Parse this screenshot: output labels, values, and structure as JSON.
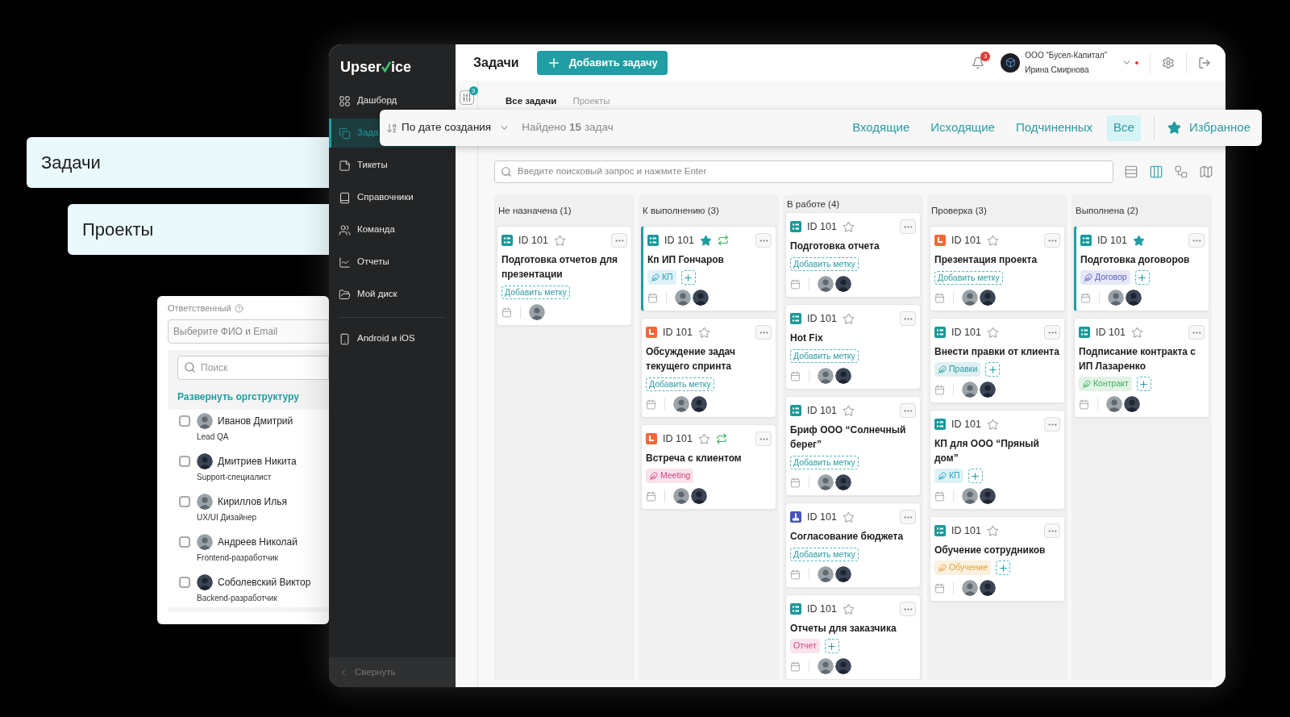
{
  "callouts": [
    {
      "label": "Задачи"
    },
    {
      "label": "Проекты"
    }
  ],
  "assignee_panel": {
    "label": "Ответственный",
    "select": {
      "placeholder": "Выберите ФИО и Email"
    },
    "search": {
      "placeholder": "Поиск"
    },
    "link": "Развернуть оргструктуру",
    "people": [
      {
        "name": "Иванов Дмитрий",
        "role": "Lead QA",
        "checked": false,
        "avatar": {
          "kind": "light"
        }
      },
      {
        "name": "Дмитриев Никита",
        "role": "Support-специалист",
        "checked": false,
        "avatar": {
          "kind": "dark"
        }
      },
      {
        "name": "Кириллов Илья",
        "role": "UX/UI Дизайнер",
        "checked": false,
        "avatar": {
          "kind": "light"
        }
      },
      {
        "name": "Андреев Николай",
        "role": "Frontend-разработчик",
        "checked": false,
        "avatar": {
          "kind": "light"
        }
      },
      {
        "name": "Соболевский Виктор",
        "role": "Backend-разработчик",
        "checked": false,
        "avatar": {
          "kind": "dark"
        }
      }
    ]
  },
  "sidebar": {
    "logo_start": "Upser",
    "logo_end": "ice",
    "sections": [
      [
        {
          "label": "Дашборд",
          "selected": false
        },
        {
          "label": "Зада",
          "selected": true
        },
        {
          "label": "Тикеты",
          "selected": false
        },
        {
          "label": "Справочники",
          "selected": false
        },
        {
          "label": "Команда",
          "selected": false
        },
        {
          "label": "Отчеты",
          "selected": false
        },
        {
          "label": "Мой диск",
          "selected": false
        }
      ],
      [
        {
          "label": "Android и iOS",
          "selected": false
        }
      ]
    ],
    "collapse": "Свернуть"
  },
  "header": {
    "title": "Задачи",
    "add_button": "Добавить задачу",
    "notifications": "3",
    "company": "ООО “Бусел-Капитал”",
    "user": "Ирина Смирнова",
    "alert": true
  },
  "filters_badge": "3",
  "tabs": [
    {
      "label": "Все задачи",
      "selected": true
    },
    {
      "label": "Проекты",
      "selected": false
    }
  ],
  "toolbar": {
    "sort": "По дате создания",
    "found": "Найдено **15** задач",
    "filters": [
      {
        "label": "Входящие",
        "selected": false
      },
      {
        "label": "Исходящие",
        "selected": false
      },
      {
        "label": "Подчиненных",
        "selected": false
      },
      {
        "label": "Все",
        "selected": true
      }
    ],
    "favorites": "Избранное"
  },
  "search": {
    "placeholder": "Введите поисковый запрос и нажмите Enter"
  },
  "views": [
    {
      "selected": false
    },
    {
      "selected": true
    },
    {
      "selected": false
    },
    {
      "selected": false
    }
  ],
  "board": {
    "columns": [
      {
        "title": "Не назначена (1)",
        "cards": [
          {
            "id": "ID 101",
            "kind": "list",
            "starred": false,
            "highlighted": false,
            "title": "Подготовка отчетов для презентации",
            "add_label": "Добавить метку",
            "avatars": [
              {
                "kind": "light"
              }
            ]
          }
        ]
      },
      {
        "title": "К выполнению (3)",
        "cards": [
          {
            "id": "ID 101",
            "kind": "list",
            "starred": true,
            "repeat": true,
            "highlighted": true,
            "title": "Кп ИП Гончаров",
            "tags": [
              {
                "label": "КП",
                "color": "#2aa5c4",
                "icon": true
              }
            ],
            "plus": true,
            "avatars": [
              {
                "kind": "light"
              },
              {
                "kind": "dark"
              }
            ]
          },
          {
            "id": "ID 101",
            "kind": "clock",
            "starred": false,
            "highlighted": false,
            "title": "Обсуждение задач текущего спринта",
            "add_label": "Добавить метку",
            "avatars": [
              {
                "kind": "light"
              },
              {
                "kind": "dark"
              }
            ]
          },
          {
            "id": "ID 101",
            "kind": "clock",
            "starred": false,
            "repeat": true,
            "highlighted": false,
            "title": "Встреча с клиентом",
            "tags": [
              {
                "label": "Meeting",
                "color": "#d6457f",
                "icon": true
              }
            ],
            "avatars": [
              {
                "kind": "light"
              },
              {
                "kind": "dark"
              }
            ]
          }
        ]
      },
      {
        "title": "В работе (4)",
        "cards": [
          {
            "id": "ID 101",
            "kind": "list",
            "starred": false,
            "highlighted": false,
            "title": "Подготовка отчета",
            "add_label": "Добавить метку",
            "avatars": [
              {
                "kind": "light"
              },
              {
                "kind": "dark"
              }
            ]
          },
          {
            "id": "ID 101",
            "kind": "list",
            "starred": false,
            "highlighted": false,
            "title": "Hot Fix",
            "add_label": "Добавить метку",
            "avatars": [
              {
                "kind": "light"
              },
              {
                "kind": "dark"
              }
            ]
          },
          {
            "id": "ID 101",
            "kind": "list",
            "starred": false,
            "highlighted": false,
            "title": "Бриф ООО “Солнечный берег”",
            "add_label": "Добавить метку",
            "avatars": [
              {
                "kind": "light"
              },
              {
                "kind": "dark"
              }
            ]
          },
          {
            "id": "ID 101",
            "kind": "budget",
            "starred": false,
            "highlighted": false,
            "title": "Согласование бюджета",
            "add_label": "Добавить метку",
            "avatars": [
              {
                "kind": "light"
              },
              {
                "kind": "dark"
              }
            ]
          },
          {
            "id": "ID 101",
            "kind": "list",
            "starred": false,
            "highlighted": false,
            "title": "Отчеты для заказчика",
            "tags": [
              {
                "label": "Отчет",
                "color": "#d6457f",
                "icon": false
              }
            ],
            "plus": true,
            "avatars": [
              {
                "kind": "light"
              },
              {
                "kind": "dark"
              }
            ]
          }
        ]
      },
      {
        "title": "Проверка (3)",
        "cards": [
          {
            "id": "ID 101",
            "kind": "clock",
            "starred": false,
            "highlighted": false,
            "title": "Презентация проекта",
            "add_label": "Добавить метку",
            "avatars": [
              {
                "kind": "light"
              },
              {
                "kind": "dark"
              }
            ]
          },
          {
            "id": "ID 101",
            "kind": "list",
            "starred": false,
            "highlighted": false,
            "title": "Внести правки от клиента",
            "tags": [
              {
                "label": "Правки",
                "color": "#2a9ca3",
                "icon": true
              }
            ],
            "plus": true,
            "avatars": [
              {
                "kind": "light"
              },
              {
                "kind": "dark"
              }
            ]
          },
          {
            "id": "ID 101",
            "kind": "list",
            "starred": false,
            "highlighted": false,
            "title": "КП для ООО “Пряный дом”",
            "tags": [
              {
                "label": "КП",
                "color": "#2aa5c4",
                "icon": true
              }
            ],
            "plus": true,
            "avatars": [
              {
                "kind": "light"
              },
              {
                "kind": "dark"
              }
            ]
          },
          {
            "id": "ID 101",
            "kind": "list",
            "starred": false,
            "highlighted": false,
            "title": "Обучение сотрудников",
            "tags": [
              {
                "label": "Обучение",
                "color": "#e3a133",
                "icon": true
              }
            ],
            "plus": true,
            "avatars": [
              {
                "kind": "light"
              },
              {
                "kind": "dark"
              }
            ]
          }
        ]
      },
      {
        "title": "Выполнена (2)",
        "cards": [
          {
            "id": "ID 101",
            "kind": "list",
            "starred": true,
            "highlighted": true,
            "title": "Подготовка договоров",
            "tags": [
              {
                "label": "Договор",
                "color": "#5a5fc0",
                "icon": true
              }
            ],
            "plus": true,
            "avatars": [
              {
                "kind": "light"
              },
              {
                "kind": "dark"
              }
            ]
          },
          {
            "id": "ID 101",
            "kind": "list",
            "starred": false,
            "highlighted": false,
            "title": "Подписание контракта с ИП Лазаренко",
            "tags": [
              {
                "label": "Контракт",
                "color": "#3aae5a",
                "icon": true
              }
            ],
            "plus": true,
            "avatars": [
              {
                "kind": "light"
              },
              {
                "kind": "dark"
              }
            ]
          }
        ]
      }
    ]
  }
}
